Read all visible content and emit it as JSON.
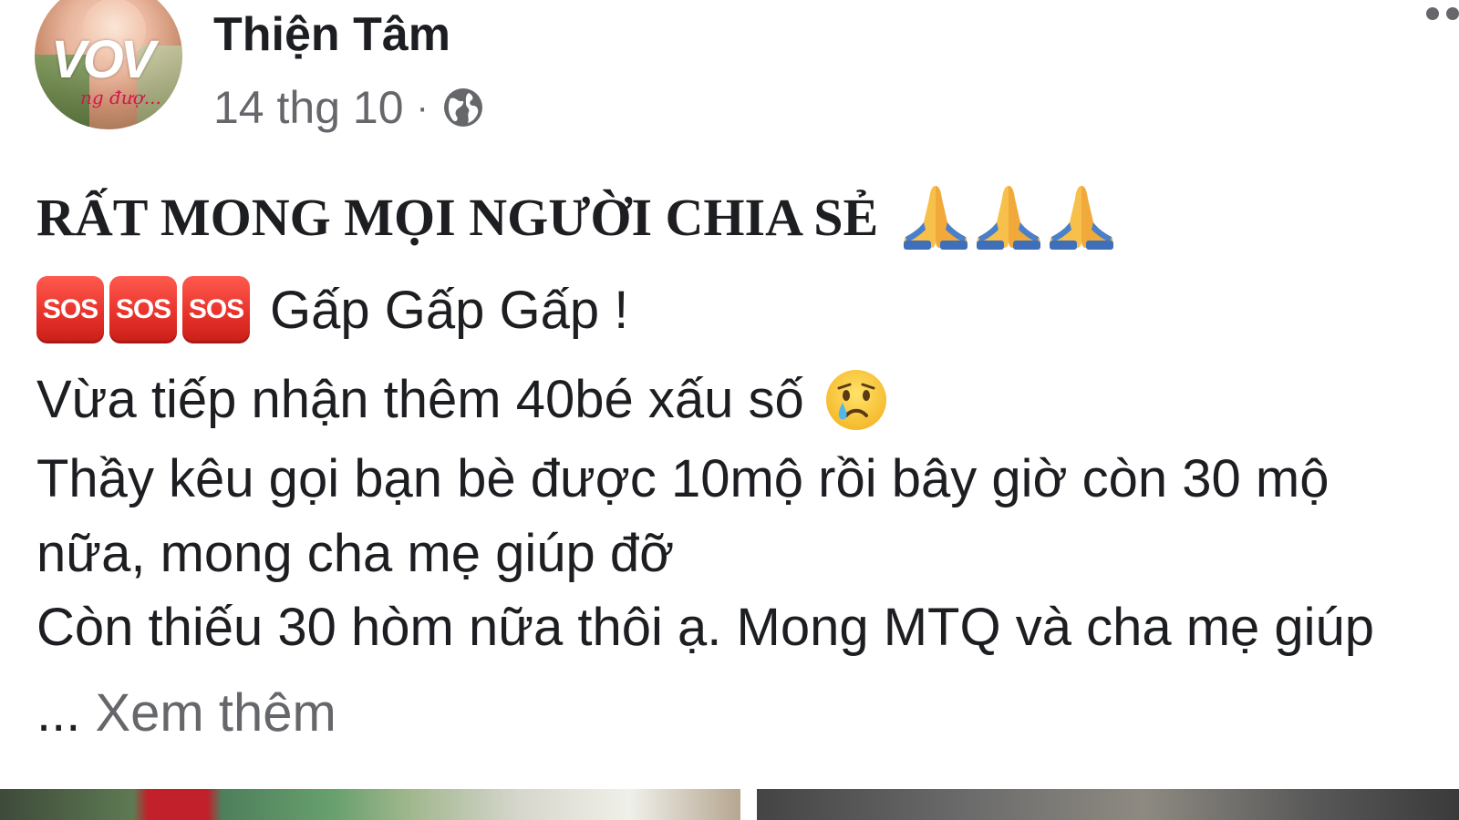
{
  "post": {
    "author": "Thiện Tâm",
    "date": "14 thg 10",
    "separator": "·",
    "privacy_icon": "globe-icon",
    "avatar_logo": "VOV",
    "avatar_caption": "ng đượ...",
    "headline": "RẤT MONG MỌI NGƯỜI CHIA SẺ",
    "headline_emoji": [
      "folded-hands-icon",
      "folded-hands-icon",
      "folded-hands-icon"
    ],
    "sos_badges": [
      "SOS",
      "SOS",
      "SOS"
    ],
    "sos_text": "Gấp Gấp Gấp !",
    "line1": "Vừa tiếp nhận thêm 40bé xấu số",
    "line1_emoji": "crying-face-icon",
    "line2": "Thầy kêu gọi bạn bè được 10mộ rồi bây giờ còn 30 mộ",
    "line3": "nữa, mong cha mẹ giúp đỡ",
    "line4": "Còn thiếu 30 hòm nữa thôi ạ. Mong MTQ và cha mẹ giúp",
    "ellipsis": "...",
    "see_more": "Xem thêm"
  },
  "colors": {
    "text": "#1c1e21",
    "secondary_text": "#65676b",
    "sos_red": "#e8332b"
  }
}
